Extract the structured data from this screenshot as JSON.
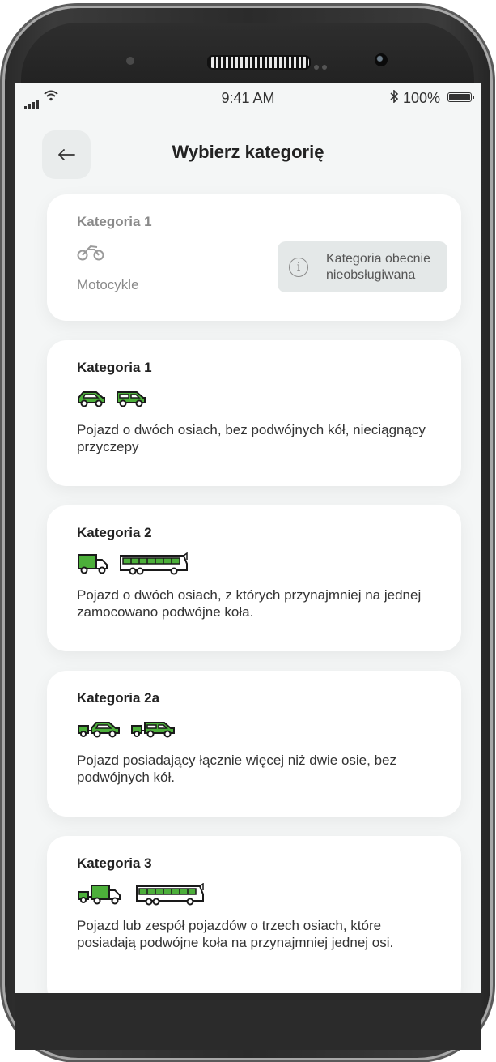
{
  "status_bar": {
    "time": "9:41 AM",
    "battery_text": "100%"
  },
  "header": {
    "title": "Wybierz kategorię",
    "back_icon": "arrow-left-icon"
  },
  "tooltip": {
    "text_line1": "Kategoria obecnie",
    "text_line2": "nieobsługiwana",
    "icon": "info-icon"
  },
  "categories": [
    {
      "title": "Kategoria 1",
      "subtitle": "Motocykle",
      "icons": [
        "motorcycle-icon"
      ],
      "disabled": true
    },
    {
      "title": "Kategoria 1",
      "description": "Pojazd o dwóch osiach, bez podwójnych kół, nieciągnący przyczepy",
      "icons": [
        "car-icon",
        "van-icon"
      ],
      "disabled": false
    },
    {
      "title": "Kategoria 2",
      "description": "Pojazd o dwóch osiach, z których przynajmniej na jednej zamocowano podwójne koła.",
      "icons": [
        "truck-icon",
        "bus-icon"
      ],
      "disabled": false
    },
    {
      "title": "Kategoria 2a",
      "description": "Pojazd posiadający łącznie więcej niż dwie osie, bez podwójnych kół.",
      "icons": [
        "car-with-trailer-icon",
        "van-with-trailer-icon"
      ],
      "disabled": false
    },
    {
      "title": "Kategoria 3",
      "description": "Pojazd lub zespół pojazdów o trzech osiach, które posiadają podwójne koła na przynajmniej jednej osi.",
      "icons": [
        "truck-with-trailer-icon",
        "bus-icon"
      ],
      "disabled": false
    }
  ],
  "colors": {
    "accent_green": "#4caf3a",
    "background": "#f4f6f6",
    "card": "#ffffff"
  }
}
